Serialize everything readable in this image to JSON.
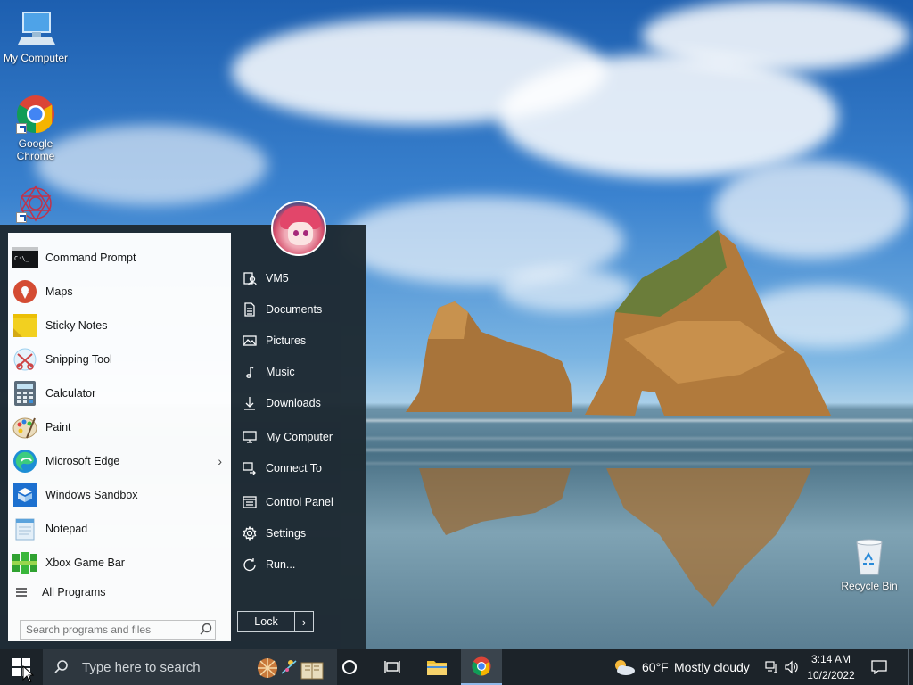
{
  "desktop": {
    "icons": [
      {
        "label": "My Computer",
        "icon": "monitor-icon"
      },
      {
        "label": "Google Chrome",
        "icon": "chrome-icon"
      },
      {
        "label": "",
        "icon": "ornament-app-icon"
      },
      {
        "label": "Recycle Bin",
        "icon": "recycle-bin-icon"
      }
    ]
  },
  "start_menu": {
    "programs": [
      {
        "label": "Command Prompt",
        "icon": "command-prompt-icon"
      },
      {
        "label": "Maps",
        "icon": "maps-pin-icon"
      },
      {
        "label": "Sticky Notes",
        "icon": "sticky-notes-icon"
      },
      {
        "label": "Snipping Tool",
        "icon": "snipping-tool-icon"
      },
      {
        "label": "Calculator",
        "icon": "calculator-icon"
      },
      {
        "label": "Paint",
        "icon": "paint-palette-icon"
      },
      {
        "label": "Microsoft Edge",
        "icon": "edge-icon",
        "has_submenu": true
      },
      {
        "label": "Windows Sandbox",
        "icon": "sandbox-icon"
      },
      {
        "label": "Notepad",
        "icon": "notepad-icon"
      },
      {
        "label": "Xbox Game Bar",
        "icon": "xbox-game-bar-icon"
      }
    ],
    "all_programs": "All Programs",
    "search_placeholder": "Search programs and files",
    "right_items": [
      {
        "label": "VM5",
        "icon": "user-folder-icon"
      },
      {
        "label": "Documents",
        "icon": "document-icon"
      },
      {
        "label": "Pictures",
        "icon": "picture-icon"
      },
      {
        "label": "Music",
        "icon": "music-note-icon"
      },
      {
        "label": "Downloads",
        "icon": "download-arrow-icon"
      },
      {
        "label": "My Computer",
        "icon": "monitor-icon"
      },
      {
        "label": "Connect To",
        "icon": "connect-icon"
      },
      {
        "label": "Control Panel",
        "icon": "control-panel-icon"
      },
      {
        "label": "Settings",
        "icon": "gear-icon"
      },
      {
        "label": "Run...",
        "icon": "run-icon"
      }
    ],
    "lock_label": "Lock",
    "lock_arrow": "›"
  },
  "taskbar": {
    "search_placeholder": "Type here to search",
    "weather_temp": "60°F",
    "weather_desc": "Mostly cloudy",
    "time": "3:14 AM",
    "date": "10/2/2022"
  },
  "colors": {
    "taskbar_bg": "#1c2329",
    "start_right_bg": "#1e2a33",
    "accent": "#8fb8e8"
  }
}
